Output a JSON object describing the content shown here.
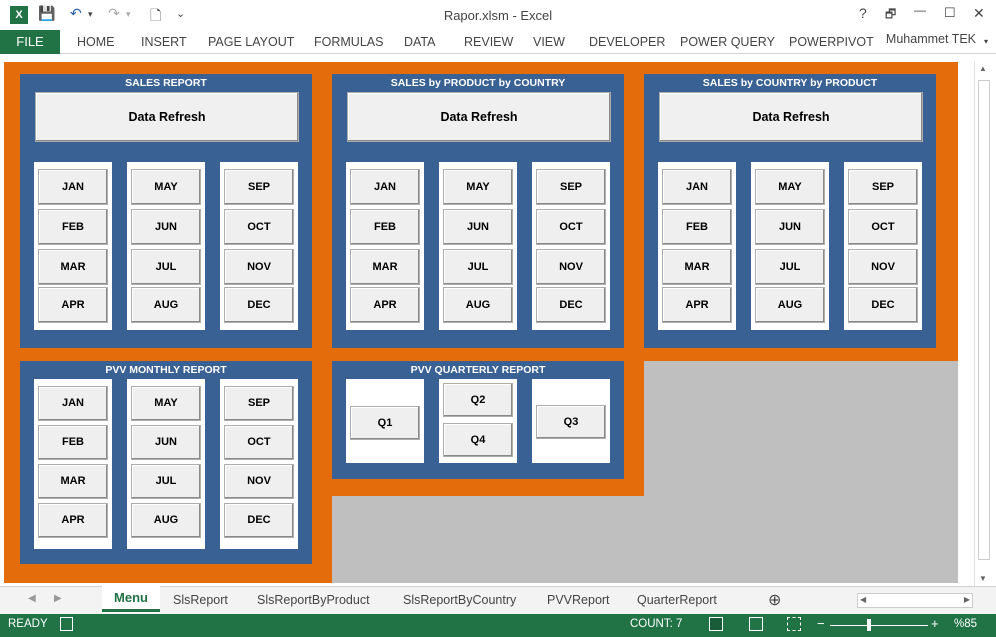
{
  "window": {
    "title": "Rapor.xlsm - Excel",
    "help": "?",
    "restore": "🗗",
    "minimize": "—",
    "maximize": "☐",
    "close": "✕"
  },
  "qat": {
    "excel_icon": "X",
    "save": "💾",
    "undo": "↶",
    "undo_caret": "▾",
    "redo": "↷",
    "redo_caret": "▾",
    "preview": "🗋",
    "more": "⌄"
  },
  "ribbon": {
    "file": "FILE",
    "tabs": [
      "HOME",
      "INSERT",
      "PAGE LAYOUT",
      "FORMULAS",
      "DATA",
      "REVIEW",
      "VIEW",
      "DEVELOPER",
      "POWER QUERY",
      "POWERPIVOT"
    ],
    "user": "Muhammet TEK",
    "user_caret": "▾"
  },
  "refresh_label": "Data Refresh",
  "panels": {
    "sales": {
      "title": "SALES REPORT"
    },
    "product": {
      "title": "SALES by PRODUCT by COUNTRY"
    },
    "country": {
      "title": "SALES by COUNTRY by PRODUCT"
    },
    "pvv_monthly": {
      "title": "PVV MONTHLY REPORT"
    },
    "pvv_quarterly": {
      "title": "PVV QUARTERLY REPORT"
    }
  },
  "months": [
    "JAN",
    "FEB",
    "MAR",
    "APR",
    "MAY",
    "JUN",
    "JUL",
    "AUG",
    "SEP",
    "OCT",
    "NOV",
    "DEC"
  ],
  "quarters": [
    "Q1",
    "Q2",
    "Q3",
    "Q4"
  ],
  "sheets": {
    "active": "Menu",
    "others": [
      "SlsReport",
      "SlsReportByProduct",
      "SlsReportByCountry",
      "PVVReport",
      "QuarterReport"
    ],
    "add": "⊕",
    "prev": "◀",
    "next": "▶"
  },
  "status": {
    "ready": "READY",
    "count": "COUNT: 7",
    "zoom": "%85",
    "zoom_minus": "−",
    "zoom_plus": "+"
  },
  "scroll": {
    "up": "▲",
    "down": "▼",
    "left": "◀",
    "right": "▶"
  },
  "colors": {
    "orange": "#E46C0A",
    "panel_blue": "#3A6193",
    "excel_green": "#217346",
    "gray_area": "#BFBFBF"
  }
}
